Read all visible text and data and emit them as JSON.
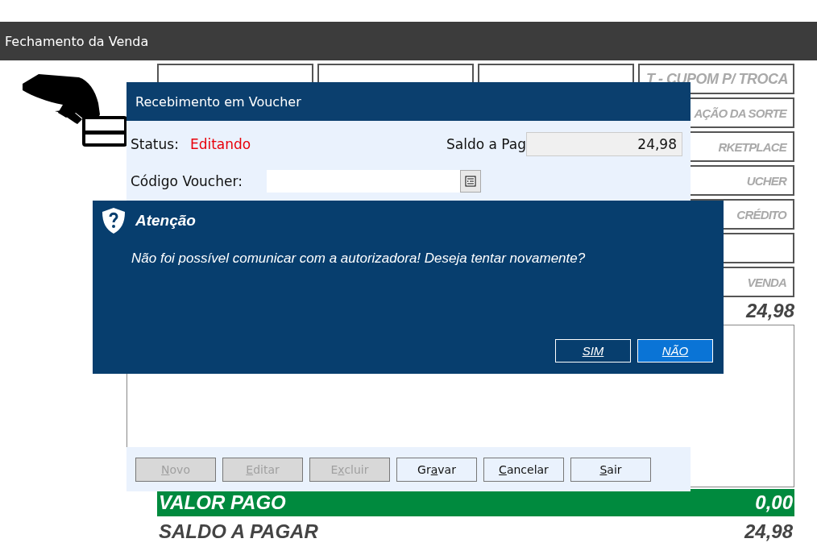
{
  "window": {
    "title": "Fechamento da Venda"
  },
  "payment_options": [
    {
      "kind": "blank"
    },
    {
      "kind": "blank"
    },
    {
      "kind": "blank"
    },
    {
      "label": "T - CUPOM P/ TROCA",
      "kind": "full"
    },
    {
      "label": "AÇÃO DA SORTE",
      "kind": "partial"
    },
    {
      "label": "RKETPLACE",
      "kind": "partial"
    },
    {
      "label": "UCHER",
      "kind": "partial"
    },
    {
      "label": "CRÉDITO",
      "kind": "partial"
    },
    {
      "kind": "blank"
    },
    {
      "label": "VENDA",
      "kind": "partial"
    }
  ],
  "total": "24,98",
  "valor_pago": {
    "label": "VALOR PAGO",
    "value": "0,00"
  },
  "saldo_a_pagar": {
    "label": "SALDO A PAGAR",
    "value": "24,98"
  },
  "voucher_dialog": {
    "title": "Recebimento em Voucher",
    "status_label": "Status:",
    "status_value": "Editando",
    "saldo_label": "Saldo a Pag",
    "saldo_value": "24,98",
    "code_label": "Código Voucher:",
    "buttons": [
      {
        "key": "N",
        "post": "ovo",
        "disabled": true
      },
      {
        "key": "E",
        "post": "ditar",
        "disabled": true
      },
      {
        "pre": "E",
        "key": "x",
        "post": "cluir",
        "disabled": true
      },
      {
        "pre": "Gr",
        "key": "a",
        "post": "var",
        "disabled": false
      },
      {
        "key": "C",
        "post": "ancelar",
        "disabled": false
      },
      {
        "key": "S",
        "post": "air",
        "disabled": false
      }
    ]
  },
  "alert": {
    "title": "Atenção",
    "message": "Não foi possível comunicar com a autorizadora! Deseja tentar novamente?",
    "buttons": [
      {
        "label": "SIM",
        "selected": false
      },
      {
        "label": "NÃO",
        "selected": true
      }
    ]
  }
}
